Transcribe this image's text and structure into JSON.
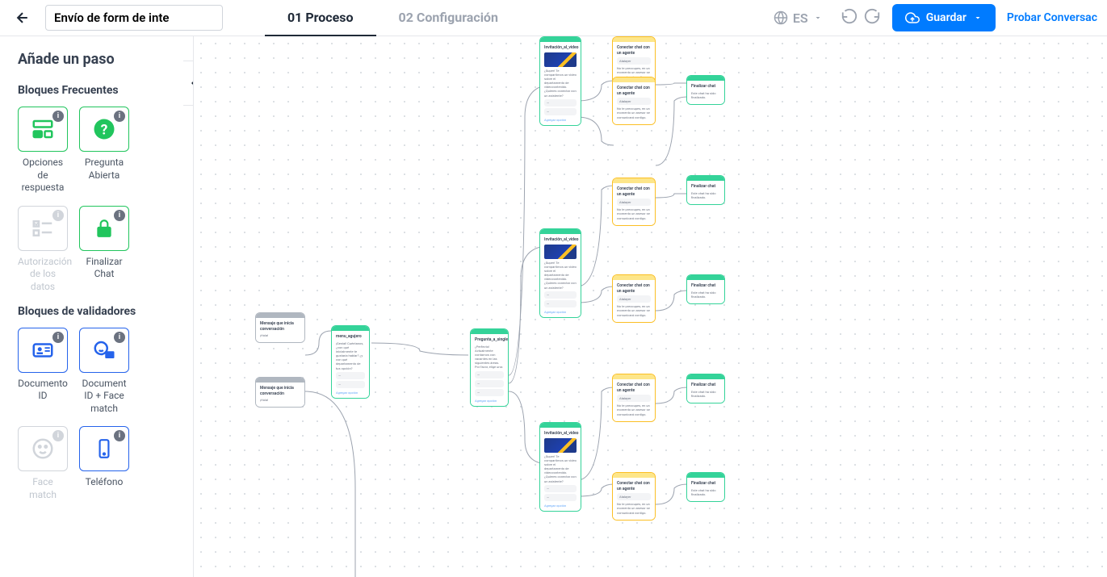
{
  "header": {
    "title_value": "Envío de form de inte",
    "tab1": "01 Proceso",
    "tab2": "02 Configuración",
    "lang": "ES",
    "save_label": "Guardar",
    "test_label": "Probar Conversac"
  },
  "sidebar": {
    "title": "Añade un paso",
    "freq_title": "Bloques Frecuentes",
    "val_title": "Bloques de validadores",
    "blocks": {
      "opciones": "Opciones de respuesta",
      "pregunta": "Pregunta Abierta",
      "autorizacion": "Autorización de los datos",
      "finalizar": "Finalizar Chat",
      "doc_id": "Documento ID",
      "doc_face": "Document ID + Face match",
      "face": "Face match",
      "telefono": "Teléfono"
    },
    "badge": "i"
  },
  "nodes": {
    "start_title": "Mensaje que inicia conversación",
    "start_text": "¡Hola!",
    "intro_title": "menu_agujero",
    "intro_text": "¡Genial! Cuéntanos, ¿con qué inicialmente te gustaría hablar? ¿y con qué departamento de tus opción?",
    "add_option": "Agregar opción",
    "branch_title": "Pregunta_a_single",
    "branch_text": "¿Perfecto! Actualmente contamos con vacantes en las siguientes áreas. Por favor, elige una:",
    "video_title": "Invitación_al_video",
    "video_text": "¿Super! Te compartimos un video sobre el departamento de videocontenido. ¿Quieres conectar con un asistente?",
    "agent_title": "Conectar chat con un agente",
    "agent_drop": "Atalayer",
    "agent_text": "No te preocupes, en un momento un asesor se comunicará contigo.",
    "end_title": "Finalizar chat",
    "end_text": "Este chat ha sido finalizado."
  }
}
